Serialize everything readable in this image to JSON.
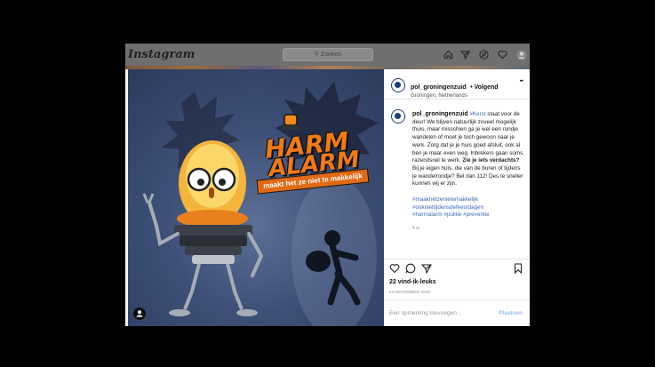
{
  "header": {
    "logo": "Instagram",
    "search_placeholder": "Zoeken",
    "nav_icons": [
      "home-icon",
      "direct-icon",
      "explore-icon",
      "heart-icon",
      "profile-icon"
    ]
  },
  "post": {
    "artwork": {
      "title_line1": "HARM",
      "title_line2": "ALARM",
      "banner": "maakt het ze niet te makkelijk"
    },
    "account": "pol_groningenzuid",
    "follow": "• Volgend",
    "location": "Groningen, Netherlands",
    "more": "•••",
    "caption": {
      "user": "pol_groningenzuid",
      "tag1": "#Kerst",
      "text1": " staat voor de deur! We blijven natuurlijk zoveel mogelijk thuis, maar misschien ga je wel een rondje wandelen of moet je toch gewoon naar je werk. Zorg dat je je huis goed afsluit, ook al ben je maar even weg. Inbrekers gaan soms razendsnel te werk. ",
      "bold": "Zie je iets verdachts?",
      "text2": " Bij je eigen huis, die van de buren of tijdens je wandelrondje? Bel dan 112! Des te sneller kunnen wij er zijn.",
      "hashtags": [
        "#maakhetzenietemakkelijk",
        "#ookniettijdensdefeestdagen",
        "#harmalarm",
        "#politie",
        "#preventie"
      ],
      "age": "4 w."
    },
    "likes": "22 vind-ik-leuks",
    "date": "24 DECEMBER 2020",
    "comment_placeholder": "Een opmerking toevoegen...",
    "post_button": "Plaatsen"
  }
}
